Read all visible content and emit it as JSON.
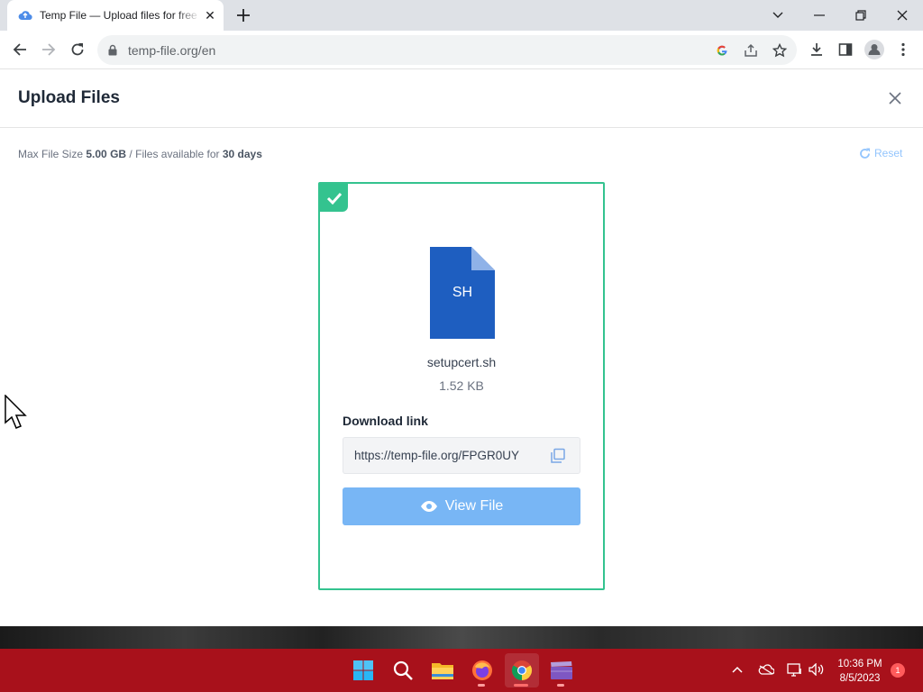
{
  "browser": {
    "tab_title": "Temp File — Upload files for free",
    "tab_close": "✕",
    "new_tab": "+",
    "url": "temp-file.org/en"
  },
  "modal": {
    "title": "Upload Files",
    "max_size_label": "Max File Size",
    "max_size_value": "5.00 GB",
    "separator": "/",
    "availability_label": "Files available for",
    "availability_value": "30 days",
    "reset_label": "Reset"
  },
  "file": {
    "extension": "SH",
    "name": "setupcert.sh",
    "size": "1.52 KB",
    "download_label": "Download link",
    "download_url": "https://temp-file.org/FPGR0UY",
    "view_button": "View File",
    "uploaded": true
  },
  "taskbar": {
    "apps": [
      "start-icon",
      "search-icon",
      "file-explorer-icon",
      "firefox-icon",
      "chrome-icon",
      "clapper-icon"
    ],
    "time": "10:36 PM",
    "date": "8/5/2023",
    "notification_count": "1"
  },
  "colors": {
    "accent_green": "#34c38f",
    "button_blue": "#78b6f5",
    "file_blue": "#1e5ec0",
    "taskbar_red": "#a8111b"
  }
}
